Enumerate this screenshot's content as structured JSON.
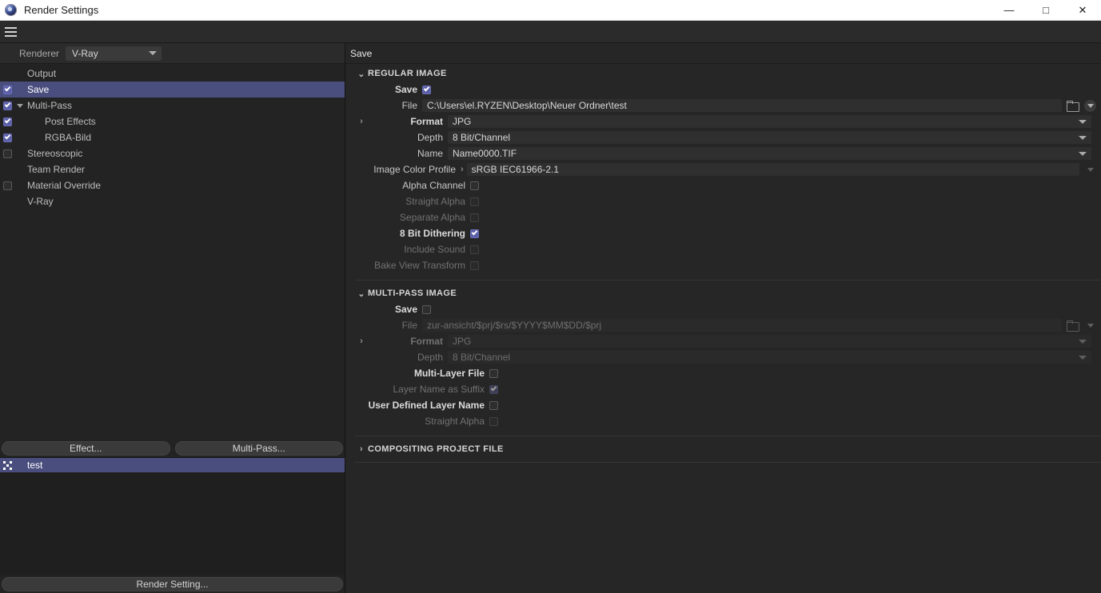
{
  "window": {
    "title": "Render Settings",
    "logo_icon": "cinema4d-logo-icon",
    "minimize_label": "—",
    "maximize_label": "□",
    "close_label": "✕"
  },
  "menubar": {
    "hamburger_icon": "hamburger-menu-icon"
  },
  "left": {
    "renderer": {
      "label": "Renderer",
      "value": "V-Ray"
    },
    "tree": [
      {
        "label": "Output",
        "checkbox": "none",
        "indent": 0,
        "selected": false,
        "twisty": "none"
      },
      {
        "label": "Save",
        "checkbox": "checked",
        "indent": 0,
        "selected": true,
        "twisty": "none"
      },
      {
        "label": "Multi-Pass",
        "checkbox": "checked",
        "indent": 0,
        "selected": false,
        "twisty": "down"
      },
      {
        "label": "Post Effects",
        "checkbox": "checked",
        "indent": 2,
        "selected": false,
        "twisty": "none"
      },
      {
        "label": "RGBA-Bild",
        "checkbox": "checked",
        "indent": 2,
        "selected": false,
        "twisty": "none"
      },
      {
        "label": "Stereoscopic",
        "checkbox": "unchecked",
        "indent": 0,
        "selected": false,
        "twisty": "none"
      },
      {
        "label": "Team Render",
        "checkbox": "none",
        "indent": 0,
        "selected": false,
        "twisty": "none"
      },
      {
        "label": "Material Override",
        "checkbox": "unchecked",
        "indent": 0,
        "selected": false,
        "twisty": "none"
      },
      {
        "label": "V-Ray",
        "checkbox": "none",
        "indent": 0,
        "selected": false,
        "twisty": "none"
      }
    ],
    "buttons": {
      "effect": "Effect...",
      "multipass": "Multi-Pass..."
    },
    "list": [
      {
        "label": "test",
        "icon": "render-setting-icon",
        "selected": true
      }
    ],
    "render_setting_button": "Render Setting..."
  },
  "right": {
    "title": "Save",
    "sections": [
      {
        "id": "regular-image",
        "header": "REGULAR IMAGE",
        "expanded": true,
        "chevron": "chevron-down-icon"
      },
      {
        "id": "multi-pass-image",
        "header": "MULTI-PASS IMAGE",
        "expanded": true,
        "chevron": "chevron-down-icon"
      },
      {
        "id": "compositing-project-file",
        "header": "COMPOSITING PROJECT FILE",
        "expanded": false,
        "chevron": "chevron-right-icon"
      }
    ],
    "regular": {
      "save": {
        "label": "Save",
        "checked": true
      },
      "file": {
        "label": "File",
        "value": "C:\\Users\\el.RYZEN\\Desktop\\Neuer Ordner\\test",
        "folder_icon": "folder-icon",
        "dropdown_icon": "chevron-down-icon"
      },
      "format": {
        "label": "Format",
        "value": "JPG",
        "twisty": "chevron-right-icon"
      },
      "depth": {
        "label": "Depth",
        "value": "8 Bit/Channel"
      },
      "name": {
        "label": "Name",
        "value": "Name0000.TIF"
      },
      "color_profile": {
        "label": "Image Color Profile",
        "value": "sRGB IEC61966-2.1",
        "arrow": "chevron-right-icon"
      },
      "checks": [
        {
          "label": "Alpha Channel",
          "checked": false,
          "enabled": true
        },
        {
          "label": "Straight Alpha",
          "checked": false,
          "enabled": false
        },
        {
          "label": "Separate Alpha",
          "checked": false,
          "enabled": false
        },
        {
          "label": "8 Bit Dithering",
          "checked": true,
          "enabled": true
        },
        {
          "label": "Include Sound",
          "checked": false,
          "enabled": false
        },
        {
          "label": "Bake View Transform",
          "checked": false,
          "enabled": false
        }
      ]
    },
    "multipass": {
      "save": {
        "label": "Save",
        "checked": false
      },
      "file": {
        "label": "File",
        "value": "zur-ansicht/$prj/$rs/$YYYY$MM$DD/$prj",
        "folder_icon": "folder-icon",
        "dropdown_icon": "chevron-down-icon"
      },
      "format": {
        "label": "Format",
        "value": "JPG",
        "twisty": "chevron-right-icon"
      },
      "depth": {
        "label": "Depth",
        "value": "8 Bit/Channel"
      },
      "checks": [
        {
          "label": "Multi-Layer File",
          "checked": false,
          "enabled": true
        },
        {
          "label": "Layer Name as Suffix",
          "checked": true,
          "enabled": false
        },
        {
          "label": "User Defined Layer Name",
          "checked": false,
          "enabled": true
        },
        {
          "label": "Straight Alpha",
          "checked": false,
          "enabled": false
        }
      ]
    }
  },
  "colors": {
    "accent_selection": "#4a4e7e",
    "checkbox_on": "#5b5fa8",
    "panel_bg": "#262626",
    "sidebar_bg": "#232323",
    "field_bg": "#2f2f2f"
  }
}
